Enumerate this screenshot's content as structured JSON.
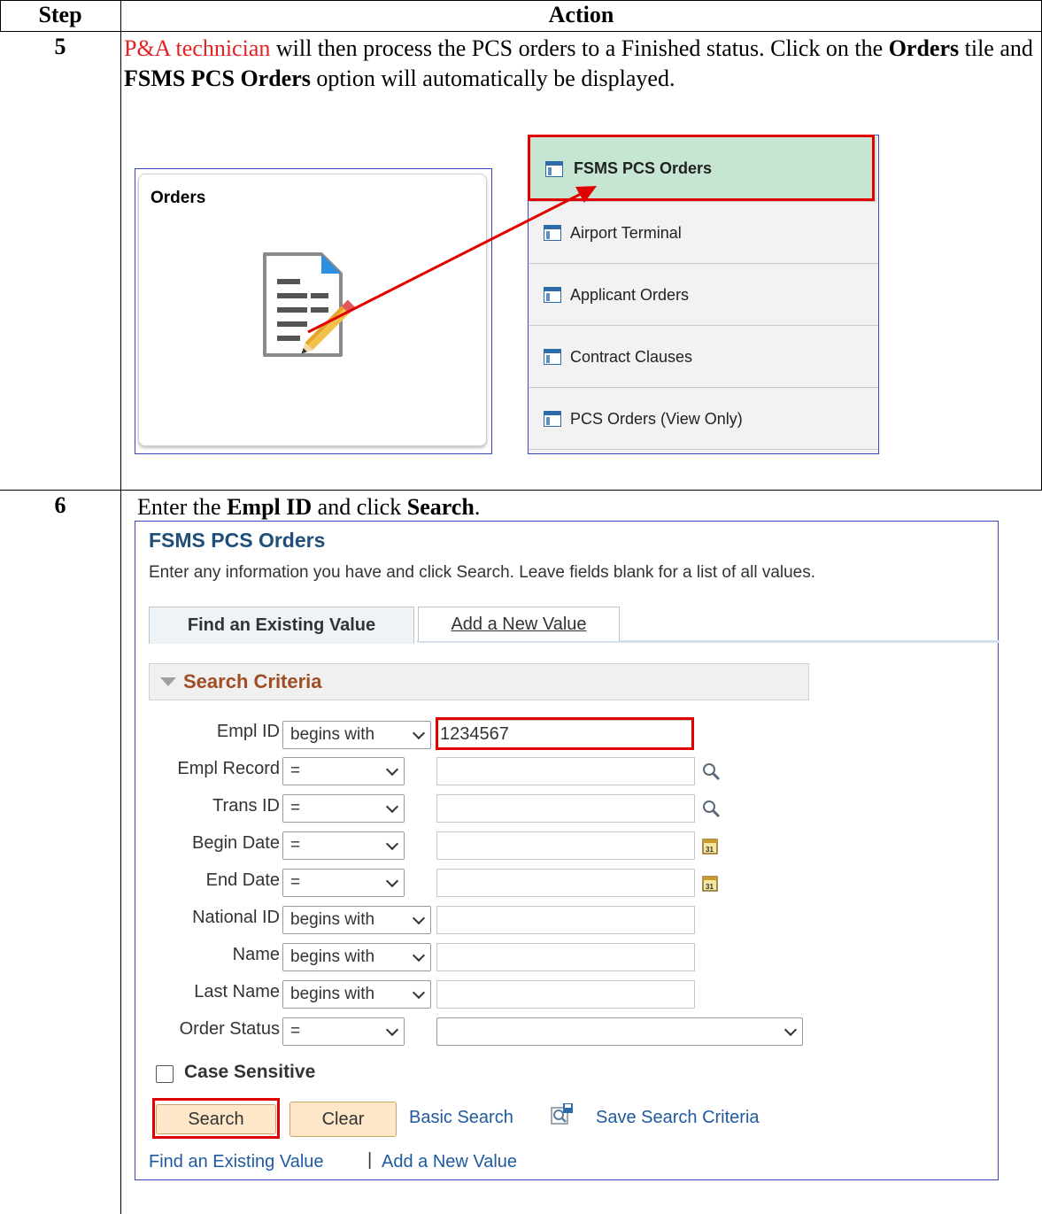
{
  "table": {
    "header_step": "Step",
    "header_action": "Action"
  },
  "step5": {
    "number": "5",
    "text_role": "P&A technician",
    "text_part1": " will then process the PCS orders to a Finished status. Click on the ",
    "text_bold1": "Orders",
    "text_part2": " tile and ",
    "text_bold2": "FSMS PCS Orders",
    "text_part3": " option will automatically be displayed.",
    "tile_title": "Orders",
    "menu_items": [
      "FSMS PCS Orders",
      "Airport Terminal",
      "Applicant Orders",
      "Contract Clauses",
      "PCS Orders (View Only)"
    ],
    "highlight_color": "#c6e6d3",
    "callout_color": "#e00000"
  },
  "step6": {
    "number": "6",
    "text_part1": "Enter the ",
    "text_bold1": "Empl ID",
    "text_part2": " and click ",
    "text_bold2": "Search",
    "text_part3": ".",
    "panel_title": "FSMS PCS Orders",
    "instructions": "Enter any information you have and click Search. Leave fields blank for a list of all values.",
    "tab_find": "Find an Existing Value",
    "tab_add": "Add a New Value",
    "search_criteria": "Search Criteria",
    "fields": [
      {
        "label": "Empl ID",
        "operator": "begins with",
        "value": "1234567"
      },
      {
        "label": "Empl Record",
        "operator": "=",
        "value": ""
      },
      {
        "label": "Trans ID",
        "operator": "=",
        "value": ""
      },
      {
        "label": "Begin Date",
        "operator": "=",
        "value": ""
      },
      {
        "label": "End Date",
        "operator": "=",
        "value": ""
      },
      {
        "label": "National ID",
        "operator": "begins with",
        "value": ""
      },
      {
        "label": "Name",
        "operator": "begins with",
        "value": ""
      },
      {
        "label": "Last Name",
        "operator": "begins with",
        "value": ""
      },
      {
        "label": "Order Status",
        "operator": "=",
        "value": ""
      }
    ],
    "case_sensitive": "Case Sensitive",
    "search_button": "Search",
    "clear_button": "Clear",
    "basic_search": "Basic Search",
    "save_search": "Save Search Criteria",
    "footer_find": "Find an Existing Value",
    "footer_separator": "|",
    "footer_add": "Add a New Value",
    "title_color": "#1f4e79",
    "criteria_color": "#a04d24"
  }
}
